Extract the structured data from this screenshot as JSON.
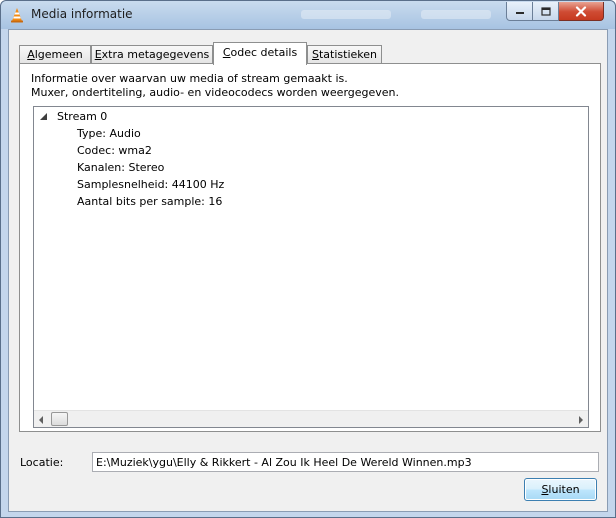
{
  "window": {
    "title": "Media informatie",
    "icon": "vlc-cone-icon",
    "controls": [
      "minimize-icon",
      "maximize-icon",
      "close-icon"
    ]
  },
  "tabs": [
    {
      "label": "Algemeen",
      "accel": "A",
      "rest": "lgemeen",
      "active": false
    },
    {
      "label": "Extra metagegevens",
      "accel": "E",
      "rest": "xtra metagegevens",
      "active": false
    },
    {
      "label": "Codec details",
      "accel": "C",
      "rest": "odec details",
      "active": true
    },
    {
      "label": "Statistieken",
      "accel": "S",
      "rest": "tatistieken",
      "active": false
    }
  ],
  "codec_panel": {
    "description_line1": "Informatie over waarvan uw media of stream gemaakt is.",
    "description_line2": "Muxer, ondertiteling, audio- en videocodecs worden weergegeven.",
    "tree": {
      "root": "Stream 0",
      "expanded": true,
      "children": [
        "Type: Audio",
        "Codec: wma2",
        "Kanalen: Stereo",
        "Samplesnelheid: 44100 Hz",
        "Aantal bits per sample: 16"
      ]
    }
  },
  "location": {
    "label": "Locatie:",
    "value": "E:\\Muziek\\ygu\\Elly & Rikkert - Al Zou Ik Heel De Wereld Winnen.mp3"
  },
  "footer": {
    "close_label": "Sluiten",
    "close_accel": "S",
    "close_rest": "luiten"
  },
  "colors": {
    "accent": "#3c7fb1",
    "close_button_red": "#c63a20"
  }
}
